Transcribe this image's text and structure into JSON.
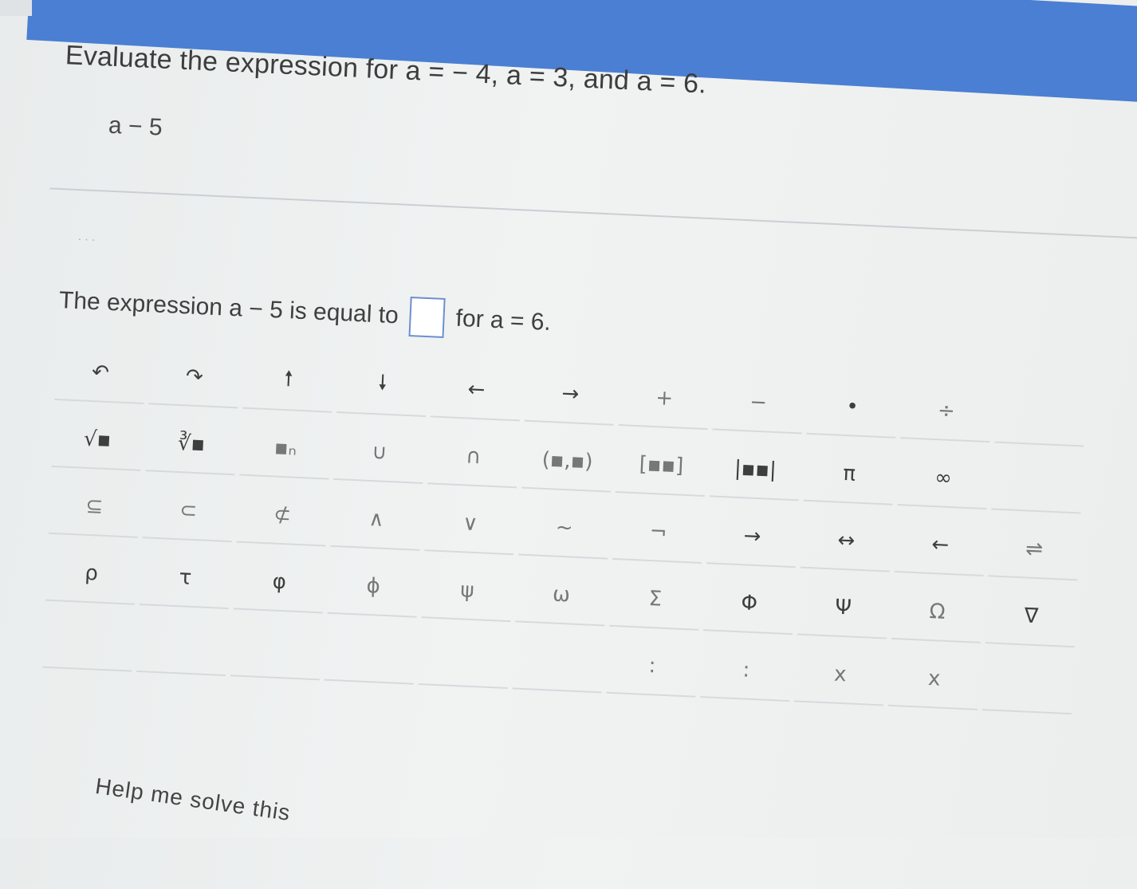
{
  "question": {
    "prefix": "Evaluate the expression for ",
    "v1": "a = − 4,",
    "v2": " a = 3,",
    "mid": " and ",
    "v3": "a = 6."
  },
  "expression": "a − 5",
  "answer": {
    "before": "The expression a − 5 is equal to",
    "after": "for a = 6."
  },
  "keypad": {
    "row1": [
      "↶",
      "↷",
      "🠕",
      "🠗",
      "←",
      "→",
      "+",
      "−",
      "•",
      "÷",
      ""
    ],
    "row2": [
      "√▪",
      "∛▪",
      "▪ₙ",
      "∪",
      "∩",
      "(▪,▪)",
      "[▪▪]",
      "|▪▪|",
      "π",
      "∞",
      ""
    ],
    "row3": [
      "⊆",
      "⊂",
      "⊄",
      "∧",
      "∨",
      "~",
      "¬",
      "→",
      "↔",
      "←",
      "⇌"
    ],
    "row4": [
      "ρ",
      "τ",
      "φ",
      "ϕ",
      "ψ",
      "ω",
      "Σ",
      "Φ",
      "Ψ",
      "Ω",
      "∇"
    ],
    "row5": [
      "",
      "",
      "",
      "",
      "",
      "",
      ":",
      ":",
      "x",
      "x",
      ""
    ]
  },
  "help_text": "Help me solve this"
}
